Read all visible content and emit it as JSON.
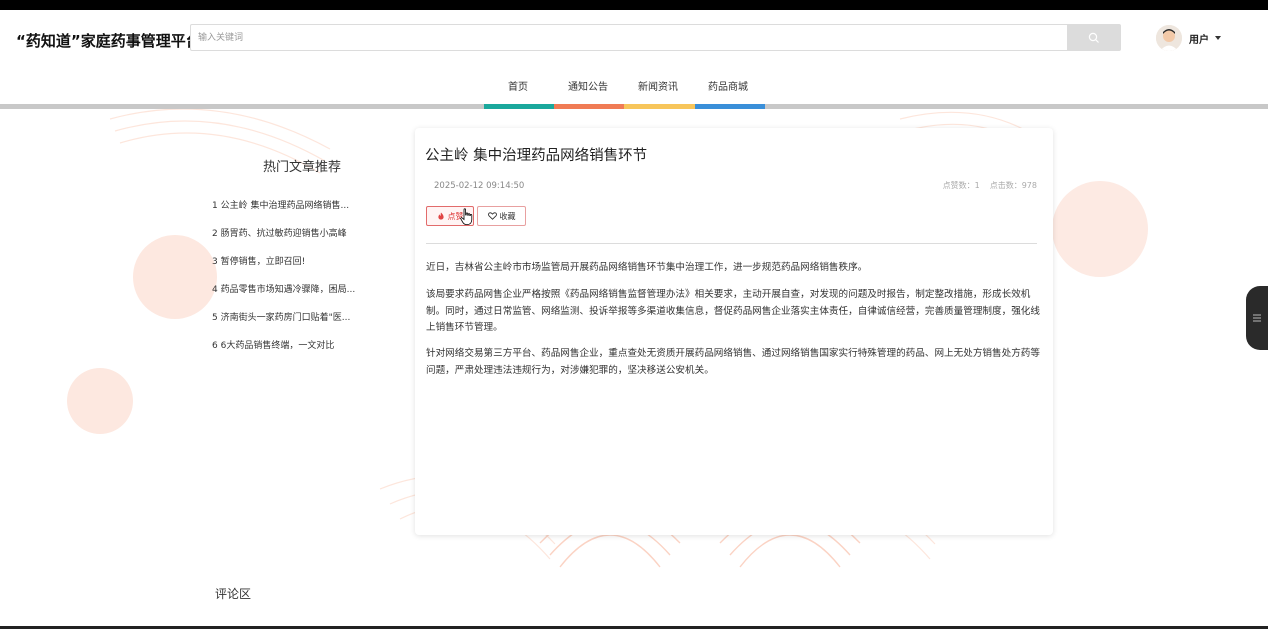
{
  "app": {
    "title": "“药知道”家庭药事管理平台"
  },
  "search": {
    "placeholder": "输入关键词",
    "value": "",
    "icon": "search-icon"
  },
  "user": {
    "name": "用户",
    "avatar_icon": "avatar-icon"
  },
  "nav": {
    "items": [
      {
        "label": "首页",
        "color": "#1aa89c"
      },
      {
        "label": "通知公告",
        "color": "#f07b55"
      },
      {
        "label": "新闻资讯",
        "color": "#f7c55a"
      },
      {
        "label": "药品商城",
        "color": "#3a8fd9"
      }
    ]
  },
  "hot": {
    "title": "热门文章推荐",
    "items": [
      {
        "index": "1",
        "title": "公主岭 集中治理药品网络销售..."
      },
      {
        "index": "2",
        "title": "肠胃药、抗过敏药迎销售小高峰"
      },
      {
        "index": "3",
        "title": "暂停销售，立即召回!"
      },
      {
        "index": "4",
        "title": "药品零售市场知遇冷骤降，困局..."
      },
      {
        "index": "5",
        "title": "济南街头一家药房门口贴着\"医..."
      },
      {
        "index": "6",
        "title": "6大药品销售终端，一文对比"
      }
    ]
  },
  "article": {
    "title": "公主岭 集中治理药品网络销售环节",
    "date": "2025-02-12 09:14:50",
    "likes_label": "点赞数：1",
    "clicks_label": "点击数：978",
    "like_button": "点赞",
    "favorite_button": "收藏",
    "paragraphs": [
      "近日，吉林省公主岭市市场监管局开展药品网络销售环节集中治理工作，进一步规范药品网络销售秩序。",
      "该局要求药品网售企业严格按照《药品网络销售监督管理办法》相关要求，主动开展自查，对发现的问题及时报告，制定整改措施，形成长效机制。同时，通过日常监管、网络监测、投诉举报等多渠道收集信息，督促药品网售企业落实主体责任，自律诚信经营，完善质量管理制度，强化线上销售环节管理。",
      "针对网络交易第三方平台、药品网售企业，重点查处无资质开展药品网络销售、通过网络销售国家实行特殊管理的药品、网上无处方销售处方药等问题，严肃处理违法违规行为，对涉嫌犯罪的，坚决移送公安机关。"
    ]
  },
  "comments": {
    "label": "评论区"
  },
  "colors": {
    "accent_red": "#e26b6b",
    "bg_decor": "#fde3da"
  }
}
